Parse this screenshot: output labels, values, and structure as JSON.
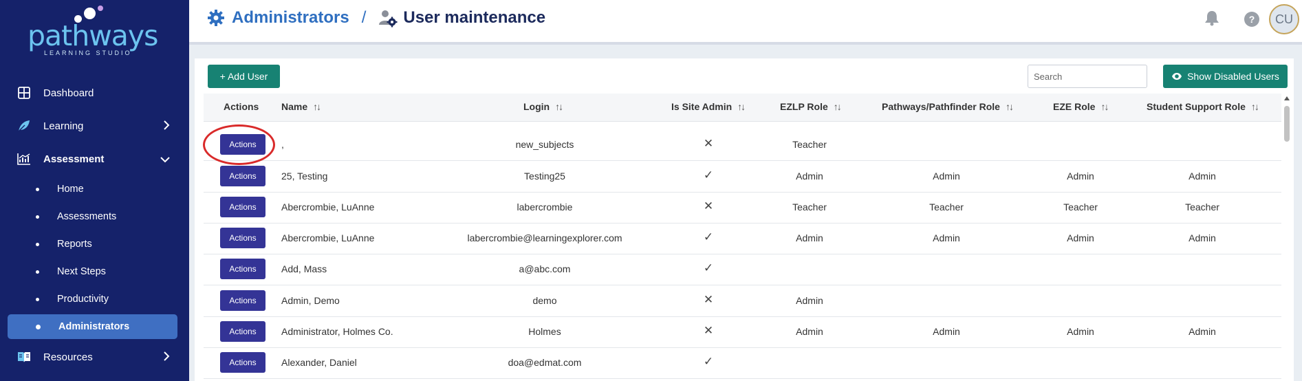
{
  "sidebar": {
    "logo_text": "pathways",
    "logo_sub": "LEARNING STUDIO",
    "items": [
      {
        "label": "Dashboard"
      },
      {
        "label": "Learning"
      },
      {
        "label": "Assessment"
      },
      {
        "label": "Resources"
      }
    ],
    "sub_items": [
      {
        "label": "Home"
      },
      {
        "label": "Assessments"
      },
      {
        "label": "Reports"
      },
      {
        "label": "Next Steps"
      },
      {
        "label": "Productivity"
      },
      {
        "label": "Administrators"
      }
    ]
  },
  "header": {
    "crumb1": "Administrators",
    "separator": "/",
    "crumb2": "User maintenance",
    "avatar": "CU"
  },
  "toolbar": {
    "add_user": "+ Add User",
    "search_placeholder": "Search",
    "show_disabled": "Show Disabled Users"
  },
  "table": {
    "columns": [
      "Actions",
      "Name",
      "Login",
      "Is Site Admin",
      "EZLP Role",
      "Pathways/Pathfinder Role",
      "EZE Role",
      "Student Support Role"
    ],
    "action_label": "Actions",
    "rows": [
      {
        "name": ",",
        "login": "new_subjects",
        "site_admin": "✕",
        "ezlp": "Teacher",
        "pathways": "",
        "eze": "",
        "support": ""
      },
      {
        "name": "25, Testing",
        "login": "Testing25",
        "site_admin": "✓",
        "ezlp": "Admin",
        "pathways": "Admin",
        "eze": "Admin",
        "support": "Admin"
      },
      {
        "name": "Abercrombie, LuAnne",
        "login": "labercrombie",
        "site_admin": "✕",
        "ezlp": "Teacher",
        "pathways": "Teacher",
        "eze": "Teacher",
        "support": "Teacher"
      },
      {
        "name": "Abercrombie, LuAnne",
        "login": "labercrombie@learningexplorer.com",
        "site_admin": "✓",
        "ezlp": "Admin",
        "pathways": "Admin",
        "eze": "Admin",
        "support": "Admin"
      },
      {
        "name": "Add, Mass",
        "login": "a@abc.com",
        "site_admin": "✓",
        "ezlp": "",
        "pathways": "",
        "eze": "",
        "support": ""
      },
      {
        "name": "Admin, Demo",
        "login": "demo",
        "site_admin": "✕",
        "ezlp": "Admin",
        "pathways": "",
        "eze": "",
        "support": ""
      },
      {
        "name": "Administrator, Holmes Co.",
        "login": "Holmes",
        "site_admin": "✕",
        "ezlp": "Admin",
        "pathways": "Admin",
        "eze": "Admin",
        "support": "Admin"
      },
      {
        "name": "Alexander, Daniel",
        "login": "doa@edmat.com",
        "site_admin": "✓",
        "ezlp": "",
        "pathways": "",
        "eze": "",
        "support": ""
      }
    ]
  }
}
